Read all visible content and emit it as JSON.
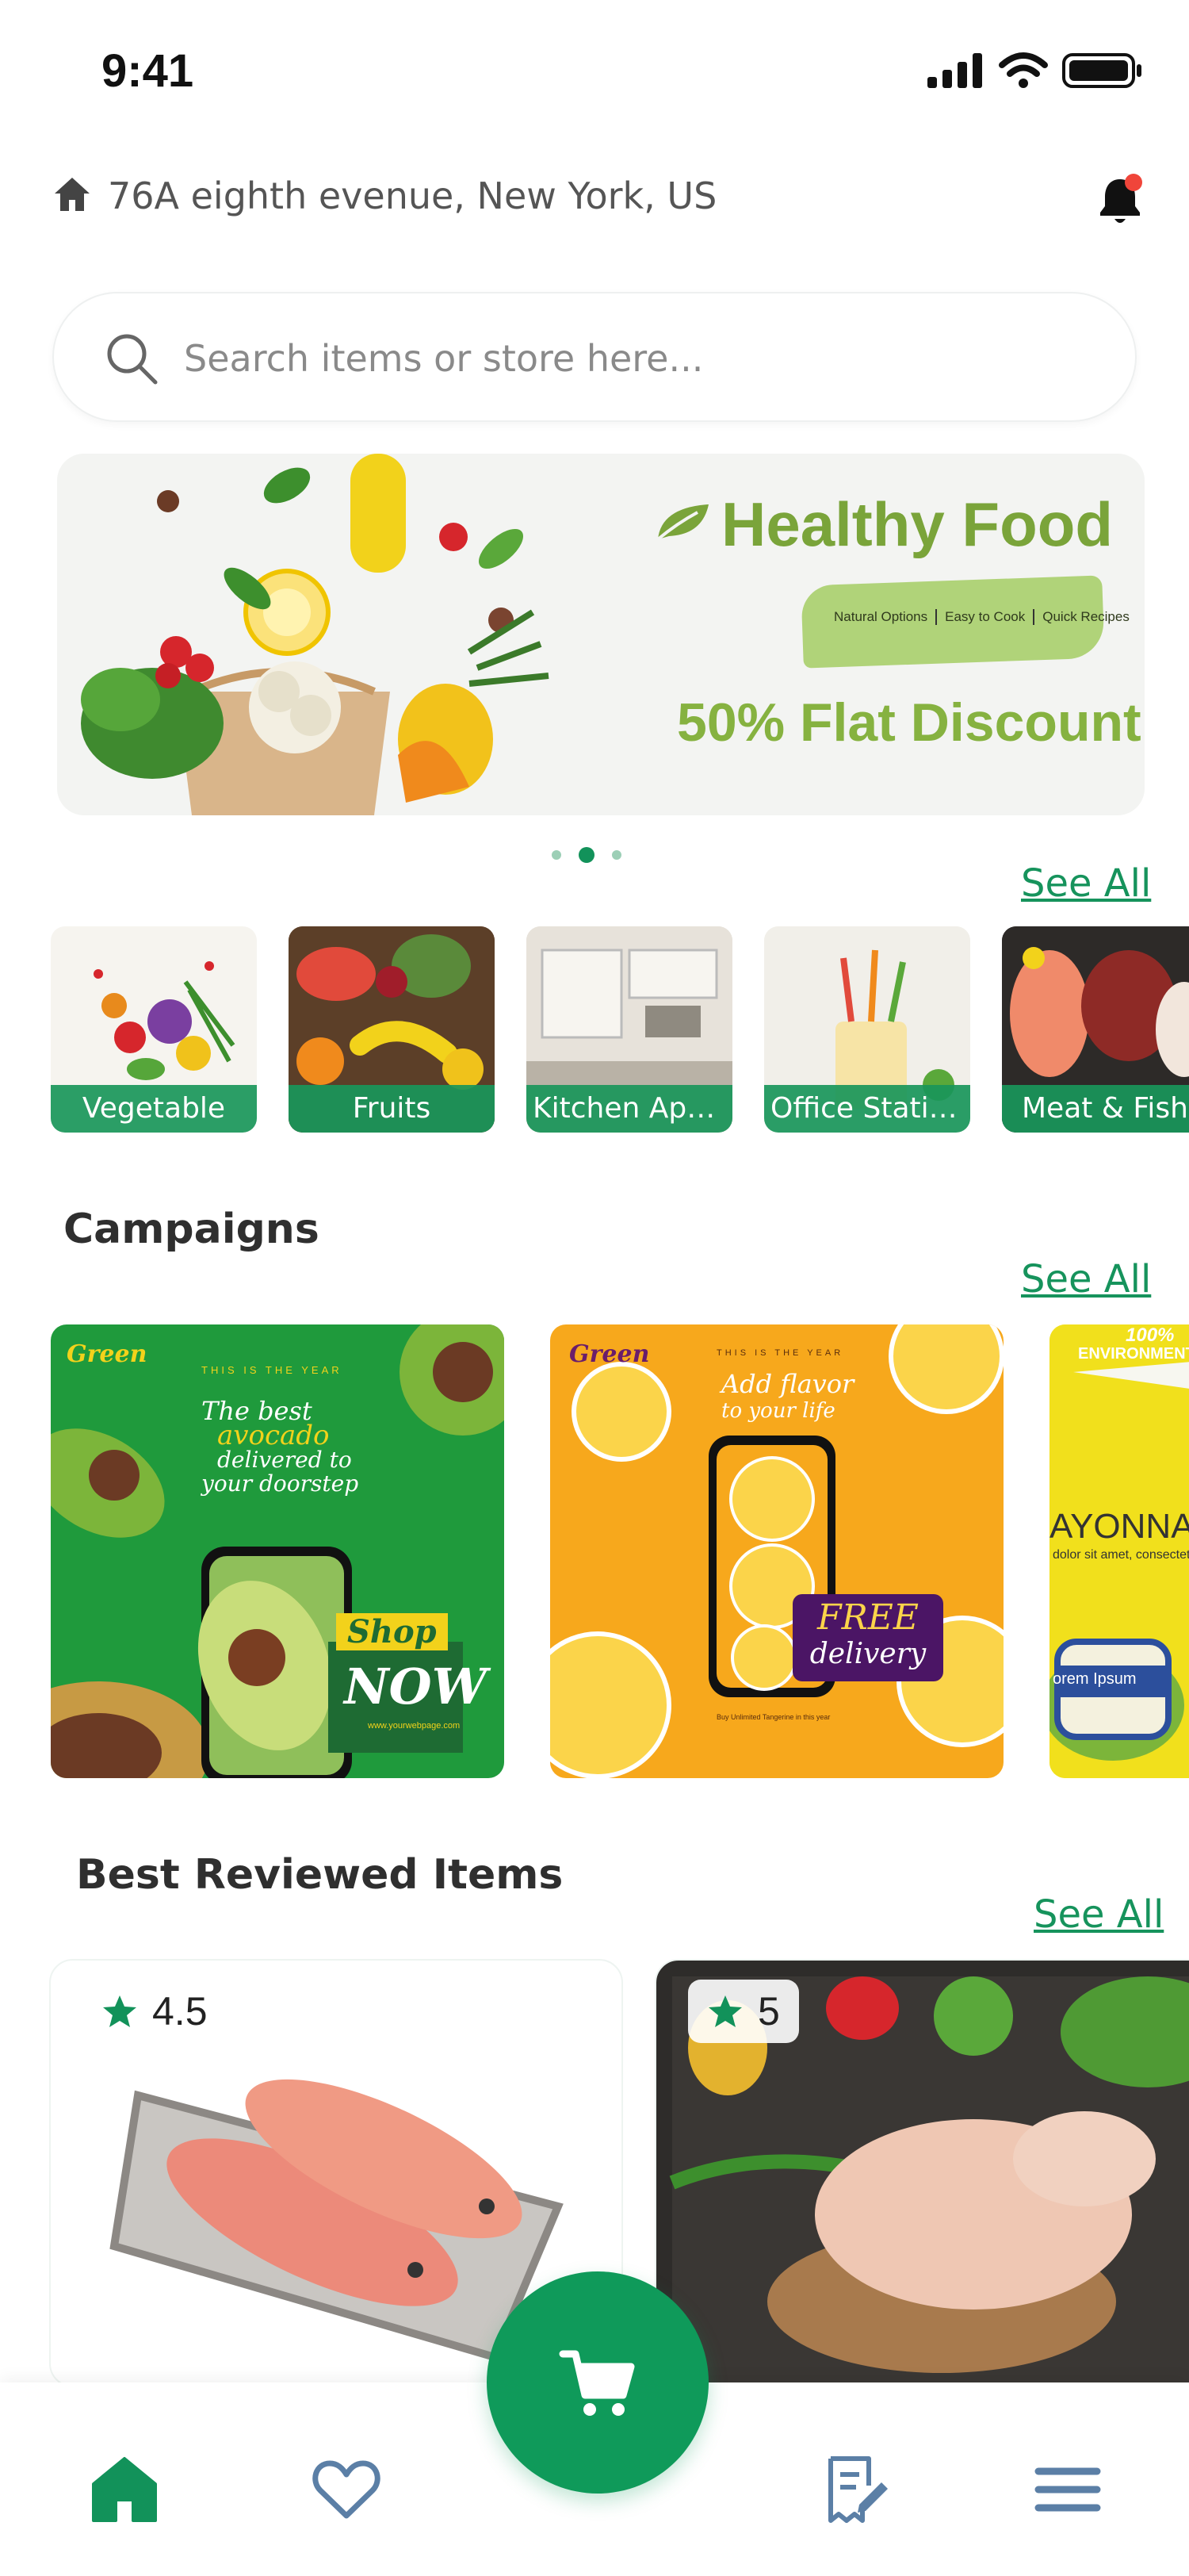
{
  "status_bar": {
    "time": "9:41"
  },
  "header": {
    "address": "76A eighth evenue, New York, US"
  },
  "search": {
    "placeholder": "Search items or store here..."
  },
  "banner": {
    "title": "Healthy Food",
    "tags": [
      "Natural Options",
      "Easy to Cook",
      "Quick Recipes"
    ],
    "discount": "50% Flat Discount",
    "page_count": 3,
    "active_page": 2
  },
  "categories": {
    "see_all": "See All",
    "items": [
      {
        "label": "Vegetable"
      },
      {
        "label": "Fruits"
      },
      {
        "label": "Kitchen App..."
      },
      {
        "label": "Office Statio..."
      },
      {
        "label": "Meat & Fish"
      }
    ]
  },
  "campaigns": {
    "title": "Campaigns",
    "see_all": "See All",
    "cards": [
      {
        "brand": "Green",
        "tagline": "THIS IS THE YEAR",
        "headline_1": "The best",
        "headline_2": "avocado",
        "headline_3": "delivered to",
        "headline_4": "your doorstep",
        "badge_1": "Shop",
        "badge_2": "NOW",
        "url": "www.yourwebpage.com"
      },
      {
        "brand": "Green",
        "tagline": "THIS IS THE YEAR",
        "headline_1": "Add flavor",
        "headline_2": "to your life",
        "badge_1": "FREE",
        "badge_2": "delivery",
        "footer": "Buy Unlimited Tangerine in this year"
      },
      {
        "badge_line_1": "100%",
        "badge_line_2": "ENVIRONMENT",
        "title": "AYONNAIS",
        "body": "dolor sit amet, consectetur adi",
        "jar_label": "orem Ipsum"
      }
    ]
  },
  "best_reviewed": {
    "title": "Best Reviewed Items",
    "see_all": "See All",
    "items": [
      {
        "rating": "4.5"
      },
      {
        "rating": "5"
      }
    ]
  },
  "colors": {
    "primary": "#12925a",
    "accent_green": "#7aa43a",
    "notification_dot": "#f0453a",
    "nav_inactive": "#5b7fa6"
  },
  "icons": {
    "home": "home-icon",
    "bell": "bell-icon",
    "search": "search-icon",
    "star": "star-icon",
    "cart": "cart-icon",
    "heart": "heart-icon",
    "orders": "receipt-edit-icon",
    "menu": "menu-icon"
  }
}
